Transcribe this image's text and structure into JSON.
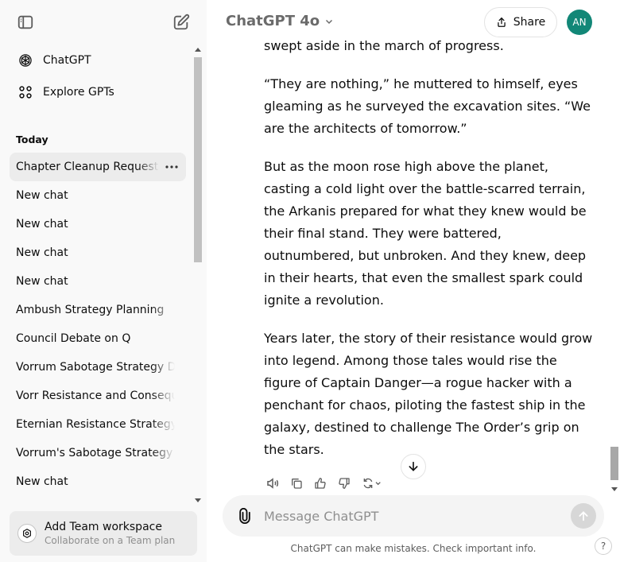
{
  "sidebar": {
    "nav": [
      {
        "label": "ChatGPT",
        "icon": "chatgpt-logo-icon"
      },
      {
        "label": "Explore GPTs",
        "icon": "grid-icon"
      }
    ],
    "section_today": "Today",
    "chats": [
      {
        "label": "Chapter Cleanup Request",
        "active": true
      },
      {
        "label": "New chat"
      },
      {
        "label": "New chat"
      },
      {
        "label": "New chat"
      },
      {
        "label": "New chat"
      },
      {
        "label": "Ambush Strategy Planning"
      },
      {
        "label": "Council Debate on Q"
      },
      {
        "label": "Vorrum Sabotage Strategy D"
      },
      {
        "label": "Vorr Resistance and Consequ"
      },
      {
        "label": "Eternian Resistance Strategy"
      },
      {
        "label": "Vorrum's Sabotage Strategy"
      },
      {
        "label": "New chat"
      }
    ],
    "team": {
      "title": "Add Team workspace",
      "subtitle": "Collaborate on a Team plan"
    }
  },
  "header": {
    "model": "ChatGPT 4o",
    "share_label": "Share",
    "avatar_initials": "AN",
    "avatar_color": "#128777"
  },
  "message": {
    "paragraphs": [
      "swept aside in the march of progress.",
      "“They are nothing,” he muttered to himself, eyes gleaming as he surveyed the excavation sites. “We are the architects of tomorrow.”",
      "But as the moon rose high above the planet, casting a cold light over the battle-scarred terrain, the Arkanis prepared for what they knew would be their final stand. They were battered, outnumbered, but unbroken. And they knew, deep in their hearts, that even the smallest spark could ignite a revolution.",
      "Years later, the story of their resistance would grow into legend. Among those tales would rise the figure of Captain Danger—a rogue hacker with a penchant for chaos, piloting the fastest ship in the galaxy, destined to challenge The Order’s grip on the stars."
    ]
  },
  "composer": {
    "placeholder": "Message ChatGPT"
  },
  "footer": {
    "disclaimer": "ChatGPT can make mistakes. Check important info.",
    "help": "?"
  }
}
